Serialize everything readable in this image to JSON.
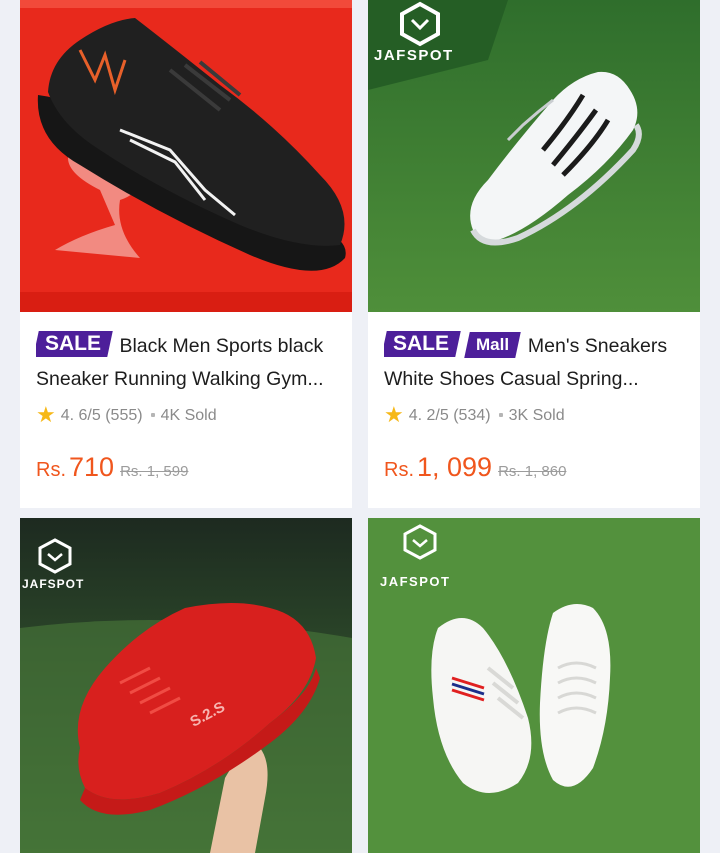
{
  "products": [
    {
      "badges": {
        "sale": "SALE"
      },
      "title_line1": "Black Men Sports black",
      "title_line2": "Sneaker Running Walking Gym...",
      "star": "★",
      "rating": "4. 6/5 (555)",
      "sold": "4K Sold",
      "currency": "Rs.",
      "price": "710",
      "original_price": "Rs.  1, 599"
    },
    {
      "badges": {
        "sale": "SALE",
        "mall": "Mall"
      },
      "brand_watermark": "JAFSPOT",
      "title_line1": "Men's Sneakers",
      "title_line2": "White Shoes Casual Spring...",
      "star": "★",
      "rating": "4. 2/5 (534)",
      "sold": "3K Sold",
      "currency": "Rs.",
      "price": "1, 099",
      "original_price": "Rs.  1, 860"
    },
    {
      "brand_watermark": "JAFSPOT",
      "image_text": "S.2.S"
    },
    {
      "brand_watermark": "JAFSPOT"
    }
  ],
  "colors": {
    "page_bg": "#eef0f6",
    "price": "#f0561d",
    "badge": "#4d1f9a",
    "star": "#f6b817"
  }
}
